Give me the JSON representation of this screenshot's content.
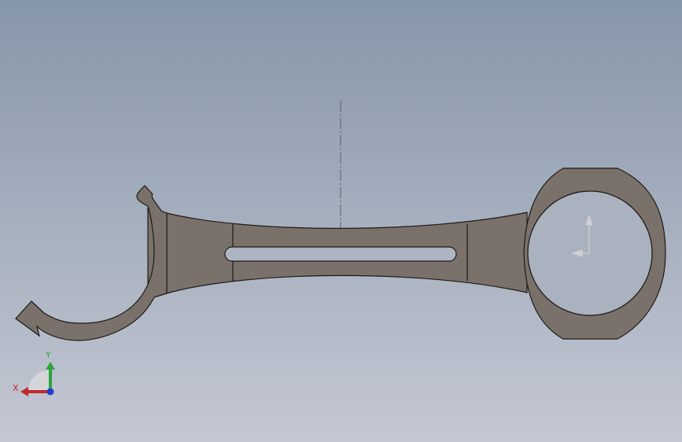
{
  "viewport": {
    "background_top": "#8696a9",
    "background_bottom": "#c4c8d3"
  },
  "part": {
    "fill_color": "#7a716a",
    "edge_color": "#1e1a18",
    "highlight_color": "#8a817a"
  },
  "triad": {
    "x_label": "X",
    "y_label": "Y",
    "x_color": "#c0282a",
    "y_color": "#2ea23c",
    "z_color": "#1f3fd0",
    "icon": "coordinate-triad-icon"
  },
  "origin_marker": {
    "icon": "origin-arrow-icon",
    "color": "#c9c9cd"
  }
}
